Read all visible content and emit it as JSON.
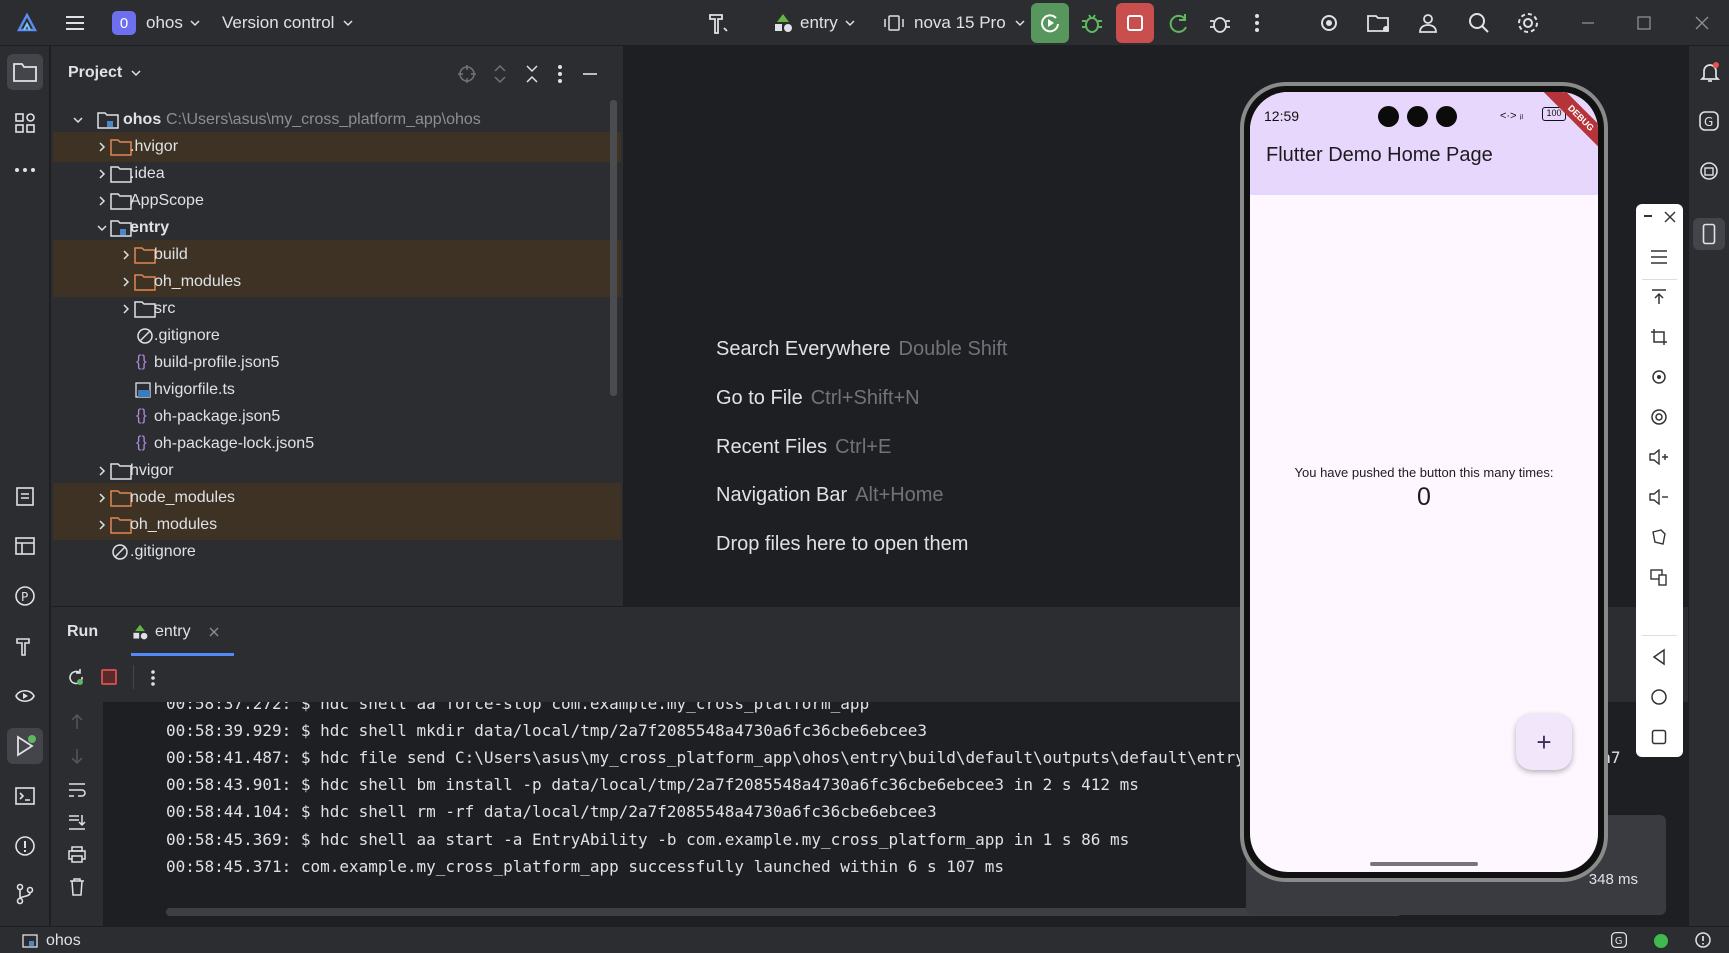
{
  "topbar": {
    "project_badge": "0",
    "project_name": "ohos",
    "version_control": "Version control",
    "run_config": "entry",
    "device": "nova 15 Pro"
  },
  "project_panel": {
    "title": "Project",
    "tree": [
      {
        "name": "ohos",
        "path": "C:\\Users\\asus\\my_cross_platform_app\\ohos",
        "type": "module-root",
        "expanded": true
      },
      {
        "name": ".hvigor",
        "type": "folder-excluded",
        "expanded": false
      },
      {
        "name": ".idea",
        "type": "folder",
        "expanded": false
      },
      {
        "name": "AppScope",
        "type": "folder",
        "expanded": false
      },
      {
        "name": "entry",
        "type": "module",
        "expanded": true
      },
      {
        "name": "build",
        "type": "folder-excluded",
        "expanded": false
      },
      {
        "name": "oh_modules",
        "type": "folder-excluded",
        "expanded": false
      },
      {
        "name": "src",
        "type": "folder",
        "expanded": false
      },
      {
        "name": ".gitignore",
        "type": "ignore-file"
      },
      {
        "name": "build-profile.json5",
        "type": "json-file"
      },
      {
        "name": "hvigorfile.ts",
        "type": "ts-file"
      },
      {
        "name": "oh-package.json5",
        "type": "json-file"
      },
      {
        "name": "oh-package-lock.json5",
        "type": "json-file"
      },
      {
        "name": "hvigor",
        "type": "folder",
        "expanded": false
      },
      {
        "name": "node_modules",
        "type": "folder-excluded",
        "expanded": false
      },
      {
        "name": "oh_modules",
        "type": "folder-excluded",
        "expanded": false
      },
      {
        "name": ".gitignore",
        "type": "ignore-file"
      }
    ]
  },
  "editor_hints": [
    {
      "action": "Search Everywhere",
      "shortcut": "Double Shift"
    },
    {
      "action": "Go to File",
      "shortcut": "Ctrl+Shift+N"
    },
    {
      "action": "Recent Files",
      "shortcut": "Ctrl+E"
    },
    {
      "action": "Navigation Bar",
      "shortcut": "Alt+Home"
    },
    {
      "action": "Drop files here to open them",
      "shortcut": ""
    }
  ],
  "run_panel": {
    "tab_run": "Run",
    "tab_entry": "entry",
    "console_lines": [
      "00:58:37.272: $ hdc shell aa force-stop com.example.my_cross_platform_app",
      "00:58:39.929: $ hdc shell mkdir data/local/tmp/2a7f2085548a4730a6fc36cbe6ebcee3",
      "00:58:41.487: $ hdc file send C:\\Users\\asus\\my_cross_platform_app\\ohos\\entry\\build\\default\\outputs\\default\\entry-default-signed.hap \"data/local/tmp/2a7",
      "00:58:43.901: $ hdc shell bm install -p data/local/tmp/2a7f2085548a4730a6fc36cbe6ebcee3 in 2 s 412 ms",
      "00:58:44.104: $ hdc shell rm -rf data/local/tmp/2a7f2085548a4730a6fc36cbe6ebcee3",
      "00:58:45.369: $ hdc shell aa start -a EntryAbility -b com.example.my_cross_platform_app in 1 s 86 ms",
      "00:58:45.371: com.example.my_cross_platform_app successfully launched within 6 s 107 ms"
    ],
    "toast_tail": "348 ms"
  },
  "phone": {
    "time": "12:59",
    "battery": "100",
    "debug_banner": "DEBUG",
    "app_title": "Flutter Demo Home Page",
    "message": "You have pushed the button this many times:",
    "counter": "0",
    "fab_label": "+"
  },
  "statusbar": {
    "project": "ohos"
  },
  "colors": {
    "ide_bg": "#1e1f22",
    "panel_bg": "#2b2d30",
    "excluded_row": "#3d3223",
    "run_green": "#57965c",
    "stop_red": "#c94f4f",
    "appbar_purple": "#e8d7fc",
    "phone_bg": "#fef7ff"
  }
}
